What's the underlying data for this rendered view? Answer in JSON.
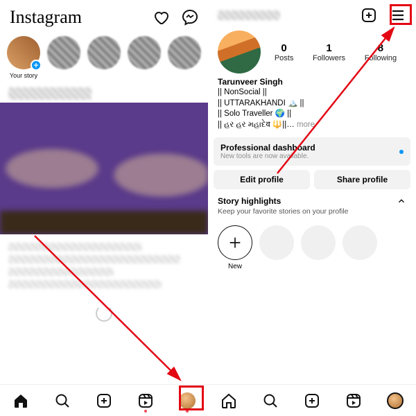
{
  "left": {
    "logo": "Instagram",
    "your_story_label": "Your story"
  },
  "right": {
    "stats": {
      "posts": {
        "value": "0",
        "label": "Posts"
      },
      "followers": {
        "value": "1",
        "label": "Followers"
      },
      "following": {
        "value": "8",
        "label": "Following"
      }
    },
    "name": "Tarunveer Singh",
    "bio_lines": [
      "|| NonSocial ||",
      "|| UTTARAKHANDI 🏔️ ||",
      "|| Solo Traveller 🌍 ||",
      "|| હર હર મહાદેव 🔱||… "
    ],
    "more": "more",
    "pro_dash_title": "Professional dashboard",
    "pro_dash_sub": "New tools are now available.",
    "edit_profile": "Edit profile",
    "share_profile": "Share profile",
    "highlights_title": "Story highlights",
    "highlights_sub": "Keep your favorite stories on your profile",
    "highlight_new": "New"
  }
}
